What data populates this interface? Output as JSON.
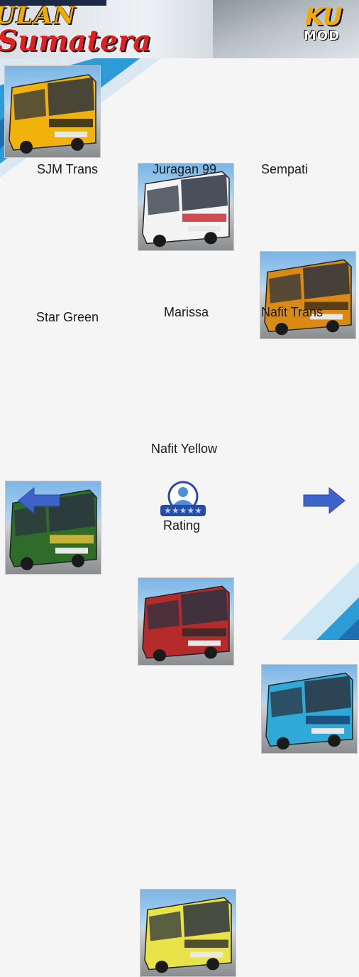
{
  "header": {
    "title_line1": "ULAN",
    "title_line2": "Sumatera",
    "brand_top": "KU",
    "brand_bottom": "MOD"
  },
  "buses": [
    {
      "label": "SJM Trans",
      "color": "#f2b20c",
      "accent": "#1b1b1b"
    },
    {
      "label": "Juragan 99",
      "color": "#f4f4f4",
      "accent": "#c8202a"
    },
    {
      "label": "Sempati",
      "color": "#d98a12",
      "accent": "#3a2a1a"
    },
    {
      "label": "Star Green",
      "color": "#2f6b2a",
      "accent": "#e8c23a"
    },
    {
      "label": "Marissa",
      "color": "#b52a2a",
      "accent": "#2a2a2a"
    },
    {
      "label": "Nafit Trans",
      "color": "#2fa9d8",
      "accent": "#1a3a6a"
    },
    {
      "label": "Nafit Yellow",
      "color": "#e9e34a",
      "accent": "#2a2a2a"
    }
  ],
  "nav": {
    "prev_icon": "arrow-left-icon",
    "next_icon": "arrow-right-icon",
    "rating_label": "Rating",
    "rating_icon": "user-rating-icon",
    "arrow_color": "#3d63c9"
  }
}
